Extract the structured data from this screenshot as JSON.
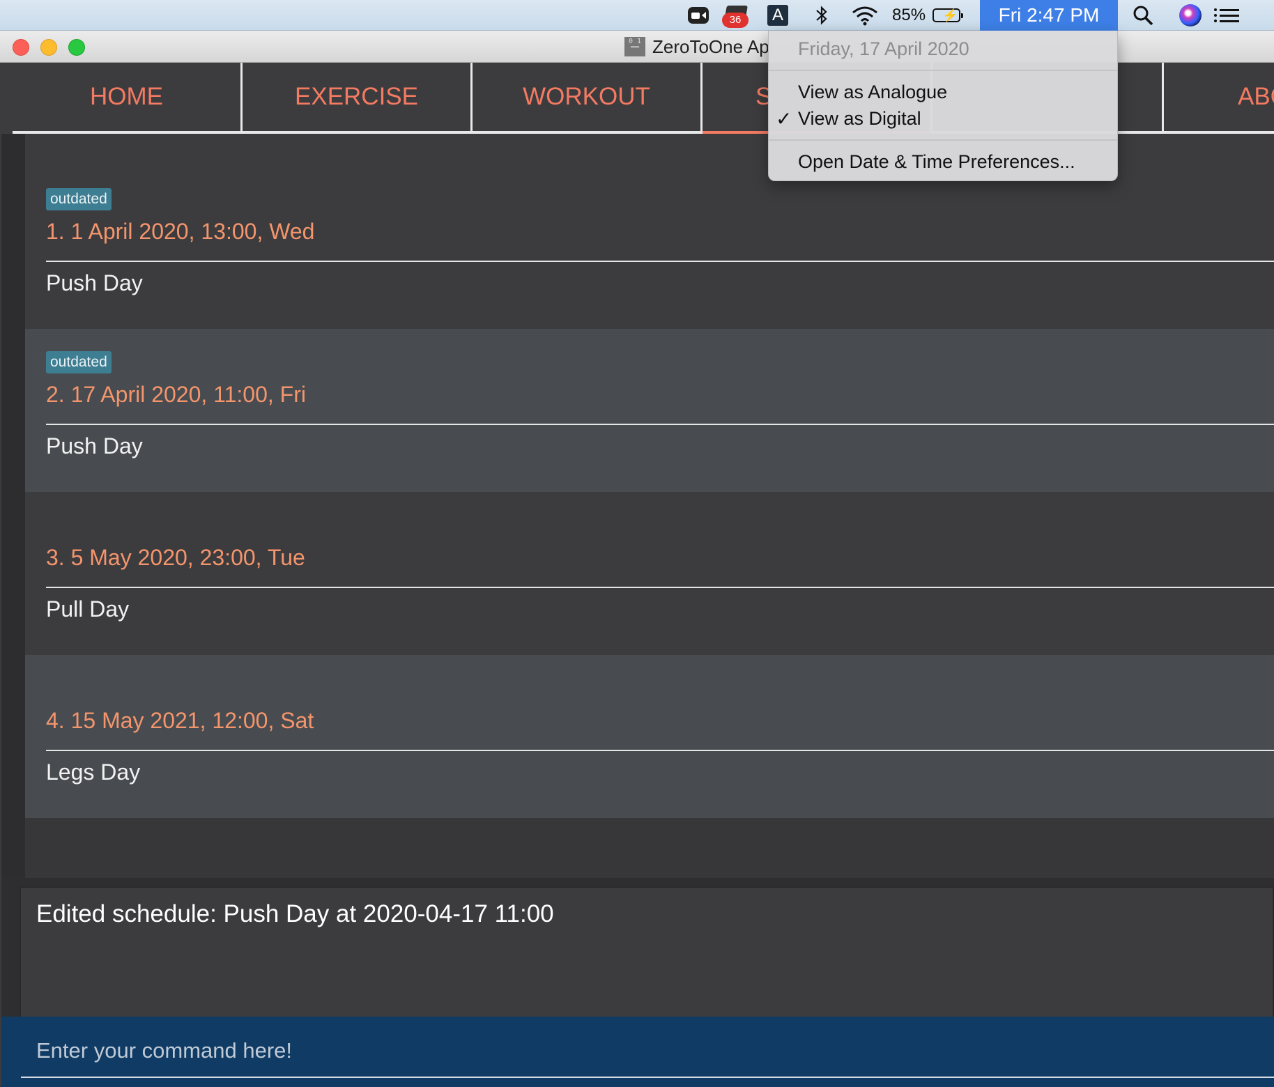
{
  "menubar": {
    "zoom_icon": "zoom-camera-icon",
    "app_badge": "36",
    "input_source": "A",
    "battery": "85%",
    "clock": "Fri 2:47 PM"
  },
  "window": {
    "title": "ZeroToOne Ap"
  },
  "tabs": [
    {
      "label": "HOME"
    },
    {
      "label": "EXERCISE"
    },
    {
      "label": "WORKOUT"
    },
    {
      "label": "S"
    },
    {
      "label": ""
    },
    {
      "label": "ABO"
    }
  ],
  "schedules": [
    {
      "tag": "outdated",
      "title": "1.  1 April 2020, 13:00, Wed",
      "name": "Push Day"
    },
    {
      "tag": "outdated",
      "title": "2.  17 April 2020, 11:00, Fri",
      "name": "Push Day"
    },
    {
      "tag": "",
      "title": "3.  5 May 2020, 23:00, Tue",
      "name": "Pull Day"
    },
    {
      "tag": "",
      "title": "4.  15 May 2021, 12:00, Sat",
      "name": "Legs Day"
    }
  ],
  "result": {
    "text": "Edited schedule: Push Day at 2020-04-17 11:00"
  },
  "command": {
    "placeholder": "Enter your command here!"
  },
  "clock_menu": {
    "date": "Friday, 17 April 2020",
    "items": [
      {
        "label": "View as Analogue",
        "checked": false
      },
      {
        "label": "View as Digital",
        "checked": true
      }
    ],
    "prefs": "Open Date & Time Preferences...",
    "check_glyph": "✓"
  },
  "colors": {
    "tab_text": "#f47a62",
    "schedule_title": "#f4956c",
    "tag_bg": "#3e7e92",
    "command_bg": "#0f3b64",
    "clock_highlight": "#3d7fe6"
  }
}
